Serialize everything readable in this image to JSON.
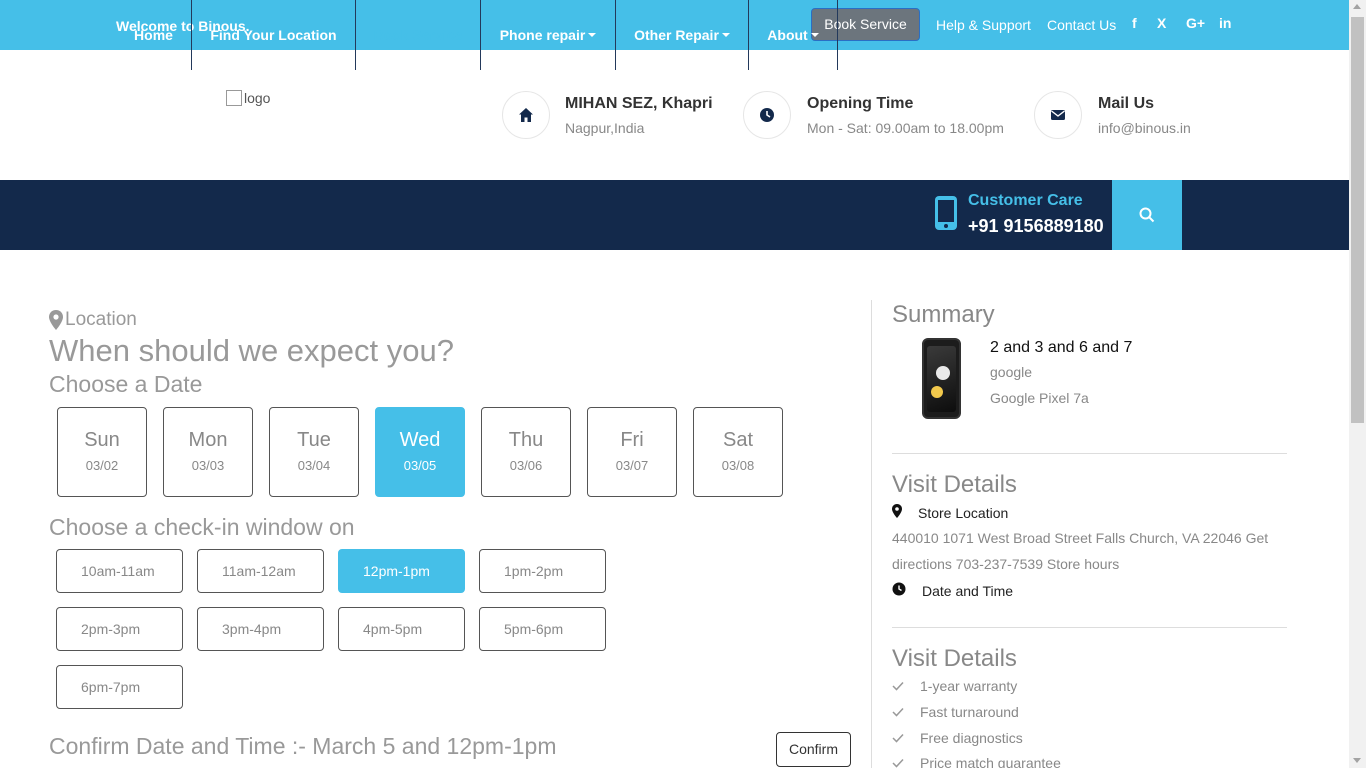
{
  "topbar": {
    "welcome": "Welcome to Binous.",
    "book_service": "Book Service",
    "help_support": "Help & Support",
    "contact_us": "Contact Us",
    "social": [
      "f",
      "X",
      "G+",
      "in"
    ]
  },
  "header": {
    "logo_alt": "logo",
    "address_title": "MIHAN SEZ, Khapri",
    "address_sub": "Nagpur,India",
    "hours_title": "Opening Time",
    "hours_sub": "Mon - Sat: 09.00am to 18.00pm",
    "mail_title": "Mail Us",
    "mail_sub": "info@binous.in"
  },
  "nav": {
    "items": [
      "Home",
      "Find Your Location",
      "Book Service",
      "Phone repair",
      "Other Repair",
      "About"
    ],
    "active": "Book Service",
    "customer_care_label": "Customer Care",
    "customer_care_phone": "+91 9156889180"
  },
  "booking": {
    "location_label": "Location",
    "heading": "When should we expect you?",
    "choose_date": "Choose a Date",
    "dates": [
      {
        "day": "Sun",
        "date": "03/02"
      },
      {
        "day": "Mon",
        "date": "03/03"
      },
      {
        "day": "Tue",
        "date": "03/04"
      },
      {
        "day": "Wed",
        "date": "03/05"
      },
      {
        "day": "Thu",
        "date": "03/06"
      },
      {
        "day": "Fri",
        "date": "03/07"
      },
      {
        "day": "Sat",
        "date": "03/08"
      }
    ],
    "selected_date": "Wed",
    "choose_window": "Choose a check-in window on",
    "windows": [
      "10am-11am",
      "11am-12am",
      "12pm-1pm",
      "1pm-2pm",
      "2pm-3pm",
      "3pm-4pm",
      "4pm-5pm",
      "5pm-6pm",
      "6pm-7pm"
    ],
    "selected_window": "12pm-1pm",
    "confirm_text": "Confirm Date and Time :- March 5 and 12pm-1pm",
    "confirm_button": "Confirm"
  },
  "summary": {
    "title": "Summary",
    "device_title": "2 and 3 and 6 and 7",
    "brand": "google",
    "model": "Google Pixel 7a",
    "visit_title": "Visit Details",
    "store_location_label": "Store Location",
    "address": "440010 1071 West Broad Street Falls Church, VA 22046 Get directions 703-237-7539 Store hours",
    "date_time_label": "Date and Time",
    "visit_title_2": "Visit Details",
    "perks": [
      "1-year warranty",
      "Fast turnaround",
      "Free diagnostics",
      "Price match guarantee"
    ]
  },
  "colors": {
    "accent": "#45bfe8",
    "navbar": "#13294b"
  }
}
